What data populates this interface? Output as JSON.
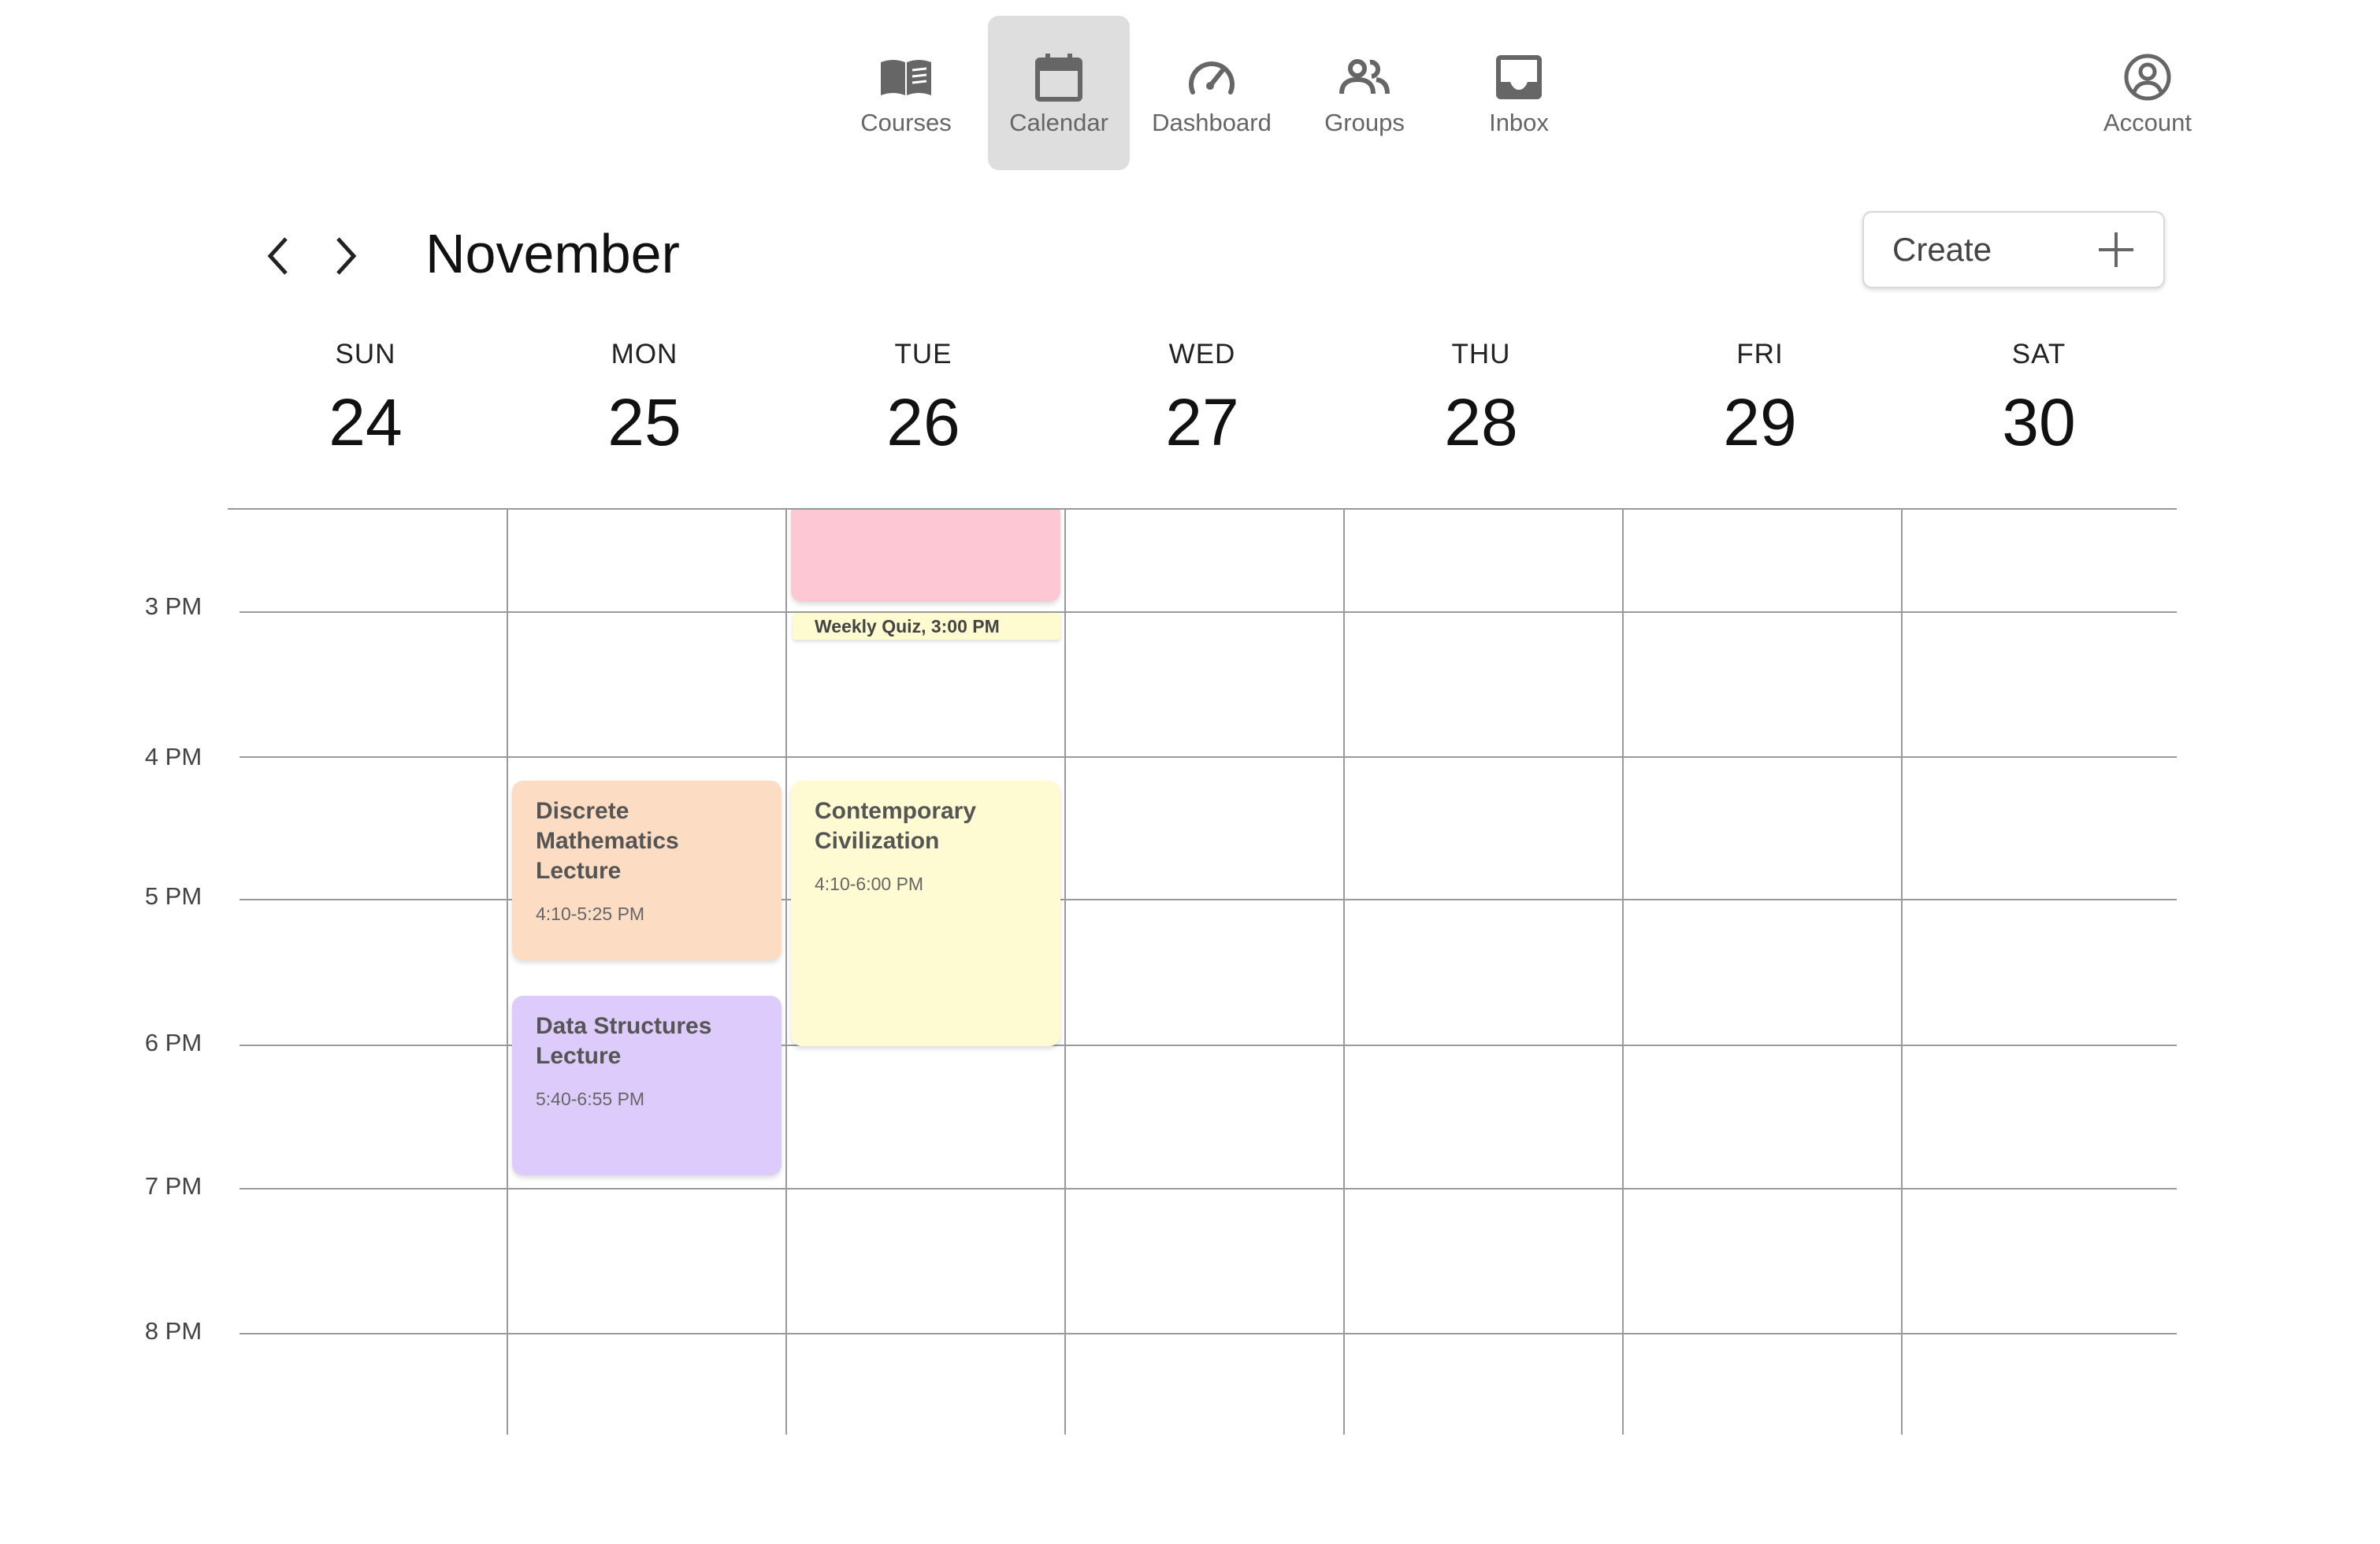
{
  "nav": {
    "items": [
      {
        "label": "Courses",
        "icon": "book-icon"
      },
      {
        "label": "Calendar",
        "icon": "calendar-icon",
        "active": true
      },
      {
        "label": "Dashboard",
        "icon": "speedometer-icon"
      },
      {
        "label": "Groups",
        "icon": "group-icon"
      },
      {
        "label": "Inbox",
        "icon": "inbox-icon"
      }
    ],
    "account_label": "Account"
  },
  "header": {
    "month": "November",
    "create_label": "Create"
  },
  "days": [
    {
      "name": "SUN",
      "num": "24"
    },
    {
      "name": "MON",
      "num": "25"
    },
    {
      "name": "TUE",
      "num": "26"
    },
    {
      "name": "WED",
      "num": "27"
    },
    {
      "name": "THU",
      "num": "28"
    },
    {
      "name": "FRI",
      "num": "29"
    },
    {
      "name": "SAT",
      "num": "30"
    }
  ],
  "times": [
    "3 PM",
    "4 PM",
    "5 PM",
    "6 PM",
    "7 PM",
    "8 PM"
  ],
  "events": {
    "discrete": {
      "title": "Discrete Mathematics Lecture",
      "time": "4:10-5:25 PM",
      "color": "#fddcc4"
    },
    "data_structures": {
      "title": "Data Structures Lecture",
      "time": "5:40-6:55 PM",
      "color": "#dccbfb"
    },
    "contemporary": {
      "title": "Contemporary Civilization",
      "time": "4:10-6:00 PM",
      "color": "#fefbd2"
    },
    "pink_event": {
      "color": "#fdc8d4"
    },
    "quiz": {
      "label": "Weekly Quiz, 3:00 PM",
      "color": "#fdfbcf"
    }
  }
}
